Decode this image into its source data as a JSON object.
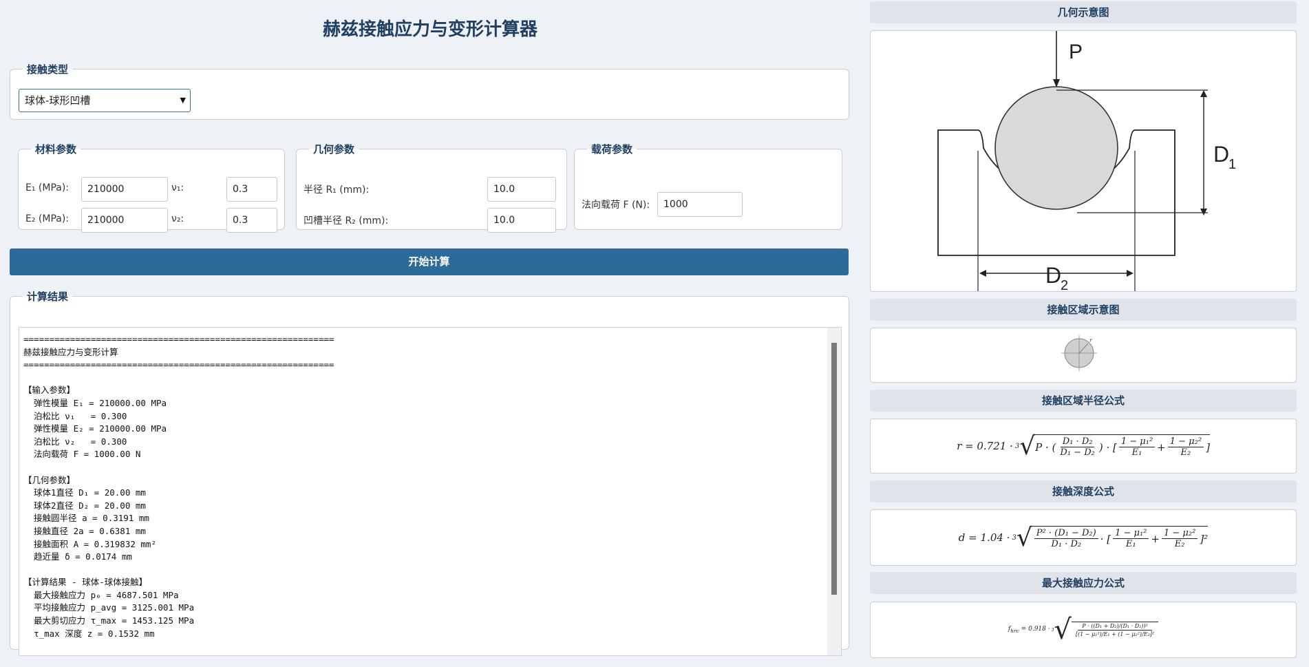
{
  "app": {
    "title": "赫兹接触应力与变形计算器"
  },
  "contact_type": {
    "legend": "接触类型",
    "selected": "球体-球形凹槽"
  },
  "material": {
    "legend": "材料参数",
    "e1_label": "E₁ (MPa):",
    "e1_value": "210000",
    "v1_label": "ν₁:",
    "v1_value": "0.3",
    "e2_label": "E₂ (MPa):",
    "e2_value": "210000",
    "v2_label": "ν₂:",
    "v2_value": "0.3"
  },
  "geometry": {
    "legend": "几何参数",
    "r1_label": "半径 R₁ (mm):",
    "r1_value": "10.0",
    "r2_label": "凹槽半径 R₂ (mm):",
    "r2_value": "10.0"
  },
  "load": {
    "legend": "载荷参数",
    "f_label": "法向载荷 F (N):",
    "f_value": "1000"
  },
  "calculate_button": "开始计算",
  "results": {
    "legend": "计算结果",
    "text": "============================================================\n赫兹接触应力与变形计算\n============================================================\n\n【输入参数】\n  弹性模量 E₁ = 210000.00 MPa\n  泊松比 ν₁   = 0.300\n  弹性模量 E₂ = 210000.00 MPa\n  泊松比 ν₂   = 0.300\n  法向载荷 F = 1000.00 N\n\n【几何参数】\n  球体1直径 D₁ = 20.00 mm\n  球体2直径 D₂ = 20.00 mm\n  接触圆半径 a = 0.3191 mm\n  接触直径 2a = 0.6381 mm\n  接触面积 A = 0.319832 mm²\n  趋近量 δ = 0.0174 mm\n\n【计算结果 - 球体-球体接触】\n  最大接触应力 p₀ = 4687.501 MPa\n  平均接触应力 p_avg = 3125.001 MPa\n  最大剪切应力 τ_max = 1453.125 MPa\n  τ_max 深度 z = 0.1532 mm\n\n============================================================"
  },
  "right_panel": {
    "geometry_diagram_title": "几何示意图",
    "diagram_labels": {
      "p": "P",
      "d1": "D",
      "d1_sub": "1",
      "d2": "D",
      "d2_sub": "2"
    },
    "contact_area_title": "接触区域示意图",
    "contact_area_label": "r",
    "radius_formula_title": "接触区域半径公式",
    "depth_formula_title": "接触深度公式",
    "stress_formula_title": "最大接触应力公式"
  },
  "colors": {
    "accent": "#2c6a99",
    "heading": "#1f3f63",
    "background": "#eef1f5"
  }
}
